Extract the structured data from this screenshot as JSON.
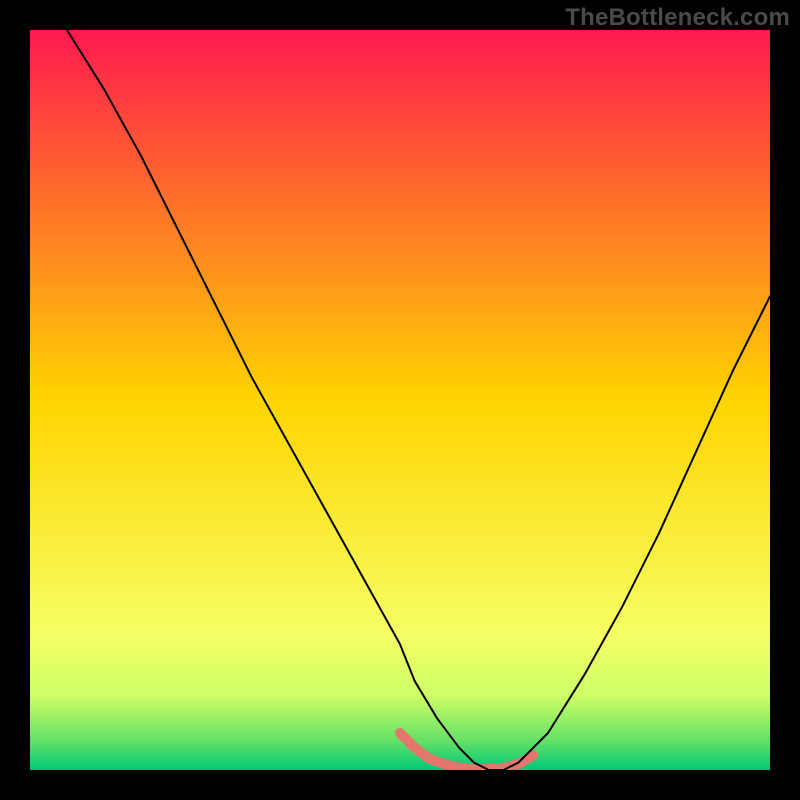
{
  "watermark": "TheBottleneck.com",
  "chart_data": {
    "type": "line",
    "title": "",
    "xlabel": "",
    "ylabel": "",
    "xlim": [
      0,
      100
    ],
    "ylim": [
      0,
      100
    ],
    "grid": false,
    "legend": false,
    "background_gradient": {
      "stops": [
        {
          "offset": 0.0,
          "color": "#ff1a4f"
        },
        {
          "offset": 0.5,
          "color": "#ffd400"
        },
        {
          "offset": 0.82,
          "color": "#f6ff66"
        },
        {
          "offset": 0.9,
          "color": "#ccff66"
        },
        {
          "offset": 0.96,
          "color": "#66e066"
        },
        {
          "offset": 1.0,
          "color": "#00c97a"
        }
      ]
    },
    "series": [
      {
        "name": "curve",
        "stroke": "#000000",
        "stroke_width": 2,
        "x": [
          5,
          10,
          15,
          20,
          25,
          30,
          35,
          40,
          45,
          50,
          52,
          55,
          58,
          60,
          62,
          64,
          66,
          70,
          75,
          80,
          85,
          90,
          95,
          100
        ],
        "y": [
          100,
          92,
          83,
          73,
          63,
          53,
          44,
          35,
          26,
          17,
          12,
          7,
          3,
          1,
          0,
          0,
          1,
          5,
          13,
          22,
          32,
          43,
          54,
          64
        ]
      },
      {
        "name": "highlight",
        "stroke": "#e3776c",
        "stroke_width": 10,
        "x": [
          50,
          52,
          54,
          56,
          58,
          60,
          62,
          64,
          66,
          68
        ],
        "y": [
          5,
          3,
          1.5,
          0.8,
          0.3,
          0.1,
          0.1,
          0.3,
          0.8,
          2
        ]
      }
    ]
  }
}
